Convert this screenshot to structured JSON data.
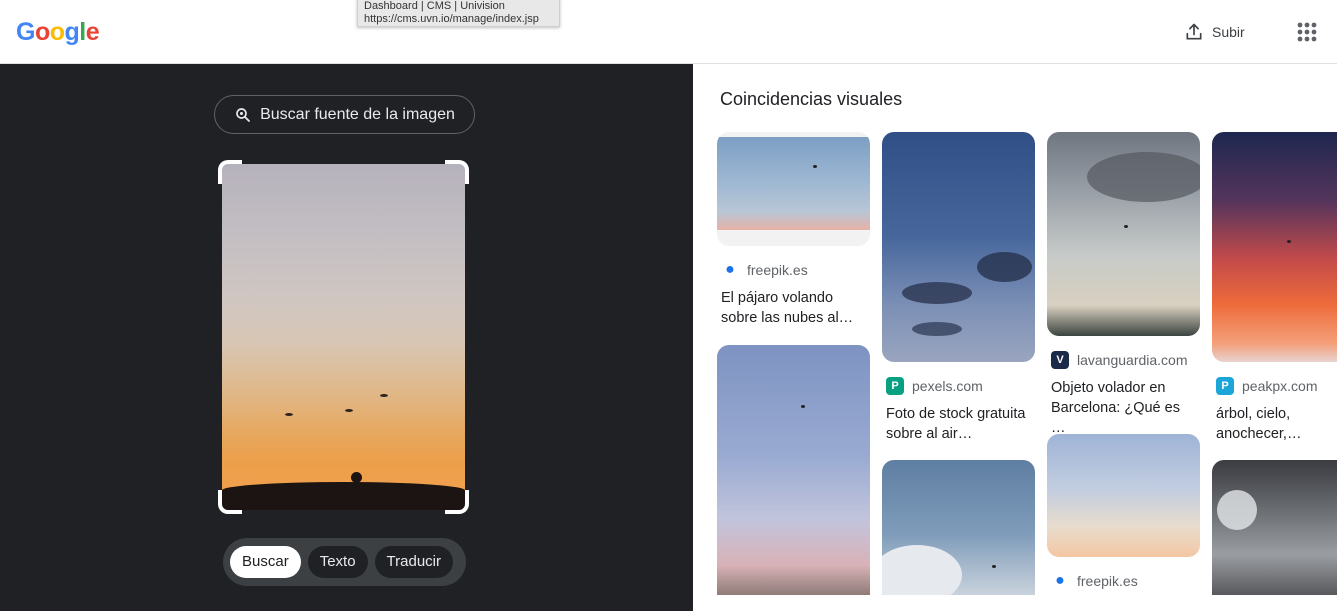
{
  "header": {
    "logo_letters": [
      {
        "ch": "G",
        "color": "#4285F4"
      },
      {
        "ch": "o",
        "color": "#EA4335"
      },
      {
        "ch": "o",
        "color": "#FBBC05"
      },
      {
        "ch": "g",
        "color": "#4285F4"
      },
      {
        "ch": "l",
        "color": "#34A853"
      },
      {
        "ch": "e",
        "color": "#EA4335"
      }
    ],
    "upload_label": "Subir",
    "apps_icon": "apps-grid-icon"
  },
  "tooltip": {
    "line1": "Dashboard | CMS | Univision",
    "line2": "https://cms.uvn.io/manage/index.jsp"
  },
  "left_panel": {
    "source_button_label": "Buscar fuente de la imagen",
    "modes": [
      {
        "label": "Buscar",
        "active": true
      },
      {
        "label": "Texto",
        "active": false
      },
      {
        "label": "Traducir",
        "active": false
      }
    ]
  },
  "results": {
    "title": "Coincidencias visuales",
    "cards": [
      {
        "source": "freepik.es",
        "favicon_color": "#1a73e8",
        "caption": "El pájaro volando sobre las nubes al…"
      },
      {
        "source": "pexels.com",
        "favicon_color": "#07a081",
        "caption": "Foto de stock gratuita sobre al air…"
      },
      {
        "source": "lavanguardia.com",
        "favicon_color": "#1c2a4a",
        "caption": "Objeto volador en Barcelona: ¿Qué es …"
      },
      {
        "source": "peakpx.com",
        "favicon_color": "#1ba5d8",
        "caption": "árbol, cielo, anochecer,…"
      },
      {
        "source": "freepik.es",
        "favicon_color": "#1a73e8",
        "caption": ""
      }
    ],
    "favicon_glyphs": {
      "pexels": "P",
      "lavanguardia": "V",
      "peakpx": "P"
    }
  }
}
